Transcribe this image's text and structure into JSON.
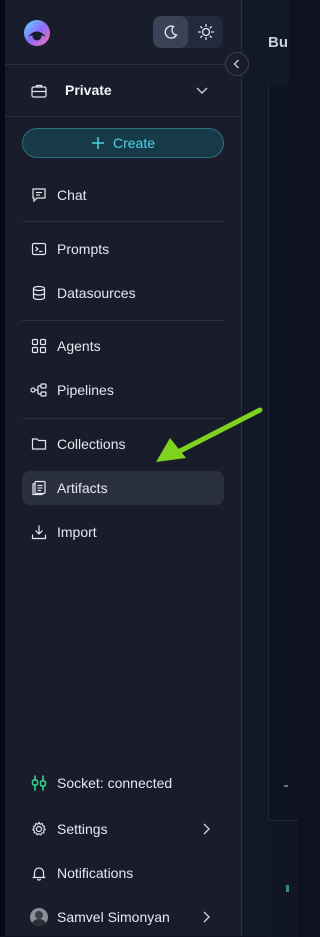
{
  "header": {
    "theme": {
      "dark_label": "",
      "light_label": ""
    },
    "workspace": {
      "label": "Private"
    },
    "create_label": "Create"
  },
  "nav": {
    "group1": [
      {
        "label": "Chat",
        "icon": "chat-icon"
      }
    ],
    "group2": [
      {
        "label": "Prompts",
        "icon": "prompt-icon"
      },
      {
        "label": "Datasources",
        "icon": "database-icon"
      }
    ],
    "group3": [
      {
        "label": "Agents",
        "icon": "grid-icon"
      },
      {
        "label": "Pipelines",
        "icon": "pipeline-icon"
      }
    ],
    "group4": [
      {
        "label": "Collections",
        "icon": "folder-icon"
      },
      {
        "label": "Artifacts",
        "icon": "artifact-icon",
        "active": true
      },
      {
        "label": "Import",
        "icon": "import-icon"
      }
    ]
  },
  "footer": {
    "socket_label": "Socket: connected",
    "settings_label": "Settings",
    "notifications_label": "Notifications",
    "user_name": "Samvel Simonyan"
  },
  "main": {
    "title": "Bu"
  },
  "colors": {
    "accent": "#4fd4e6",
    "socket_ok": "#3ecf8e",
    "annotation_arrow": "#7ed321"
  }
}
